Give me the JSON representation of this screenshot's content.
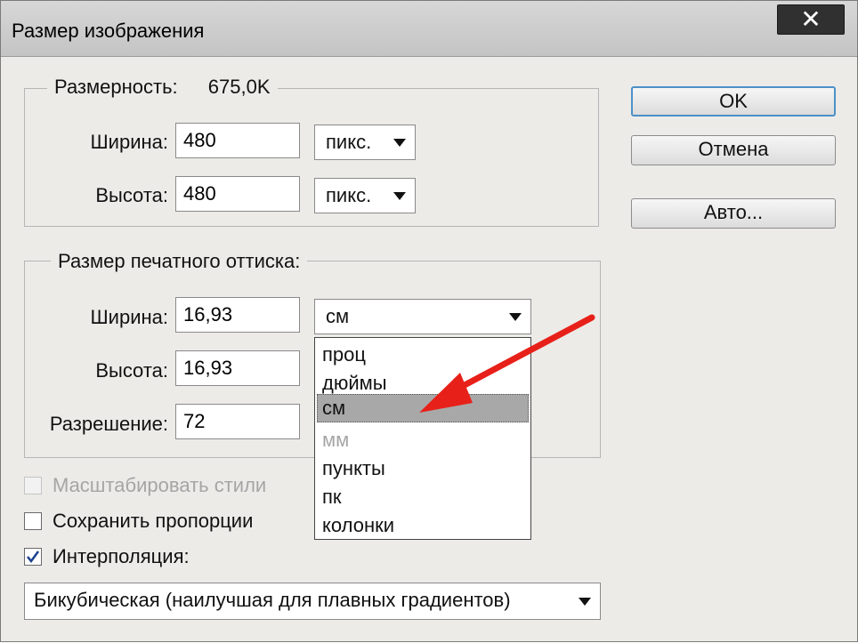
{
  "window": {
    "title": "Размер изображения",
    "close_glyph": "✕"
  },
  "pixel_dims": {
    "legend_label": "Размерность:",
    "legend_value": "675,0K",
    "width_label": "Ширина:",
    "width_value": "480",
    "width_unit": "пикс.",
    "height_label": "Высота:",
    "height_value": "480",
    "height_unit": "пикс."
  },
  "print_size": {
    "legend_label": "Размер печатного оттиска:",
    "width_label": "Ширина:",
    "width_value": "16,93",
    "width_unit": "см",
    "height_label": "Высота:",
    "height_value": "16,93",
    "resolution_label": "Разрешение:",
    "resolution_value": "72"
  },
  "unit_dropdown": {
    "options": [
      "проц",
      "дюймы",
      "см",
      "мм",
      "пункты",
      "пк",
      "колонки"
    ],
    "selected": "см"
  },
  "buttons": {
    "ok": "OK",
    "cancel": "Отмена",
    "auto": "Авто..."
  },
  "checkboxes": {
    "scale_styles": {
      "label": "Масштабировать стили",
      "checked": false,
      "enabled": false
    },
    "constrain": {
      "label": "Сохранить пропорции",
      "checked": false,
      "enabled": true
    },
    "resample": {
      "label": "Интерполяция:",
      "checked": true,
      "enabled": true
    }
  },
  "resample_method": {
    "value": "Бикубическая (наилучшая для плавных градиентов)"
  },
  "annotation": {
    "arrow_color": "#e8201a"
  }
}
